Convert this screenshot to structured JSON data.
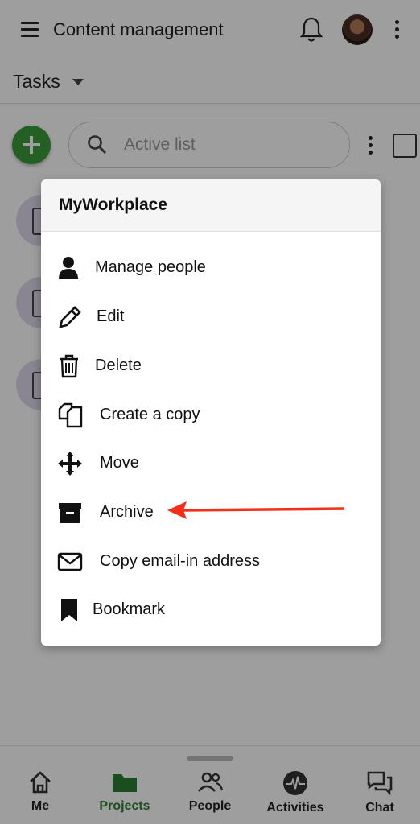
{
  "header": {
    "title": "Content management"
  },
  "subheader": {
    "title": "Tasks"
  },
  "search": {
    "placeholder": "Active list"
  },
  "sheet": {
    "title": "MyWorkplace",
    "items": [
      {
        "label": "Manage people",
        "icon": "person-icon"
      },
      {
        "label": "Edit",
        "icon": "pencil-icon"
      },
      {
        "label": "Delete",
        "icon": "trash-icon"
      },
      {
        "label": "Create a copy",
        "icon": "copy-icon"
      },
      {
        "label": "Move",
        "icon": "move-icon"
      },
      {
        "label": "Archive",
        "icon": "archive-icon"
      },
      {
        "label": "Copy email-in address",
        "icon": "envelope-icon"
      },
      {
        "label": "Bookmark",
        "icon": "bookmark-icon"
      }
    ]
  },
  "bottom_nav": {
    "items": [
      {
        "label": "Me",
        "icon": "home-icon"
      },
      {
        "label": "Projects",
        "icon": "folder-icon",
        "active": true
      },
      {
        "label": "People",
        "icon": "people-icon"
      },
      {
        "label": "Activities",
        "icon": "activity-icon"
      },
      {
        "label": "Chat",
        "icon": "chat-icon"
      }
    ]
  },
  "colors": {
    "accent_green": "#3b9a3b",
    "annotation_arrow": "#f2301a"
  }
}
